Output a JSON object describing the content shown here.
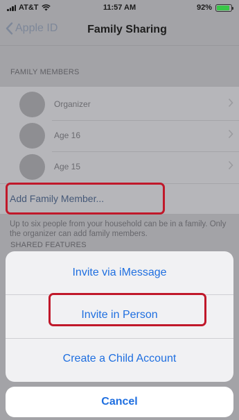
{
  "status_bar": {
    "carrier": "AT&T",
    "time": "11:57 AM",
    "battery": "92%",
    "battery_level": 0.92,
    "icons": [
      "signal-icon",
      "wifi-icon",
      "battery-icon"
    ]
  },
  "nav": {
    "back_label": "Apple ID",
    "title": "Family Sharing"
  },
  "family_members": {
    "header": "FAMILY MEMBERS",
    "members": [
      {
        "label": "Organizer"
      },
      {
        "label": "Age 16"
      },
      {
        "label": "Age 15"
      }
    ],
    "add_label": "Add Family Member..."
  },
  "note": "Up to six people from your household can be in a family. Only the organizer can add family members.",
  "shared_features": {
    "header": "SHARED FEATURES"
  },
  "action_sheet": {
    "options": [
      {
        "label": "Invite via iMessage"
      },
      {
        "label": "Invite in Person"
      },
      {
        "label": "Create a Child Account"
      }
    ],
    "cancel_label": "Cancel"
  },
  "colors": {
    "accent": "#1f6fe0",
    "highlight": "#c0182a",
    "battery_fill": "#39c648"
  }
}
